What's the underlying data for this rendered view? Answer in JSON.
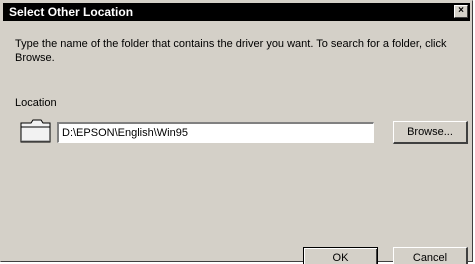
{
  "window": {
    "title": "Select Other Location",
    "close_glyph": "×"
  },
  "instructions": "Type the name of the folder that contains the driver you want. To search for a folder, click Browse.",
  "location": {
    "label": "Location",
    "value": "D:\\EPSON\\English\\Win95",
    "icon": "folder-icon"
  },
  "buttons": {
    "browse": "Browse...",
    "ok": "OK",
    "cancel": "Cancel"
  },
  "colors": {
    "dialog_face": "#d4d0c8",
    "titlebar": "#000000"
  }
}
